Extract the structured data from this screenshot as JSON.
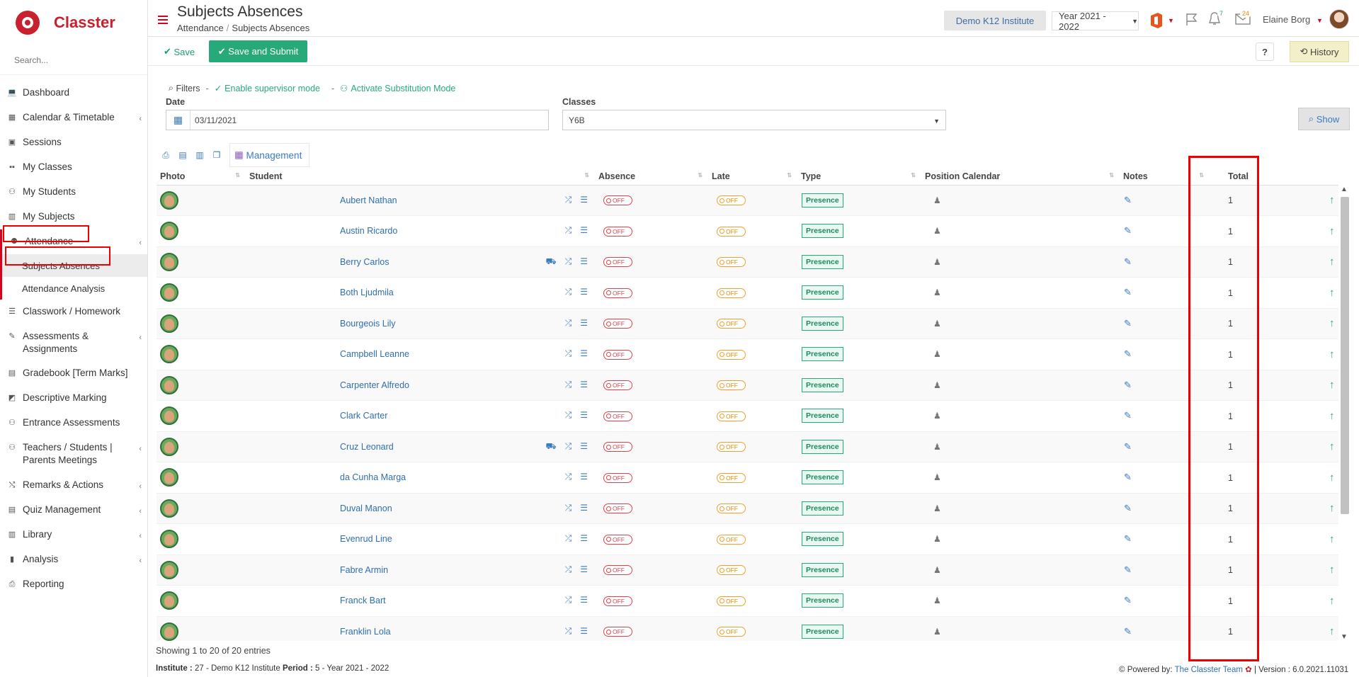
{
  "brand": {
    "name": "Classter"
  },
  "search": {
    "placeholder": "Search..."
  },
  "sidebar": {
    "items": [
      {
        "label": "Dashboard",
        "icon": "laptop-icon",
        "chevron": false
      },
      {
        "label": "Calendar & Timetable",
        "icon": "calendar-icon",
        "chevron": true
      },
      {
        "label": "Sessions",
        "icon": "sessions-icon",
        "chevron": false
      },
      {
        "label": "My Classes",
        "icon": "classes-icon",
        "chevron": false
      },
      {
        "label": "My Students",
        "icon": "students-icon",
        "chevron": false
      },
      {
        "label": "My Subjects",
        "icon": "book-icon",
        "chevron": false
      },
      {
        "label": "Attendance",
        "icon": "attendance-icon",
        "chevron": true
      }
    ],
    "sub_items": [
      {
        "label": "Subjects Absences",
        "selected": true
      },
      {
        "label": "Attendance Analysis",
        "selected": false
      }
    ],
    "items_after": [
      {
        "label": "Classwork / Homework",
        "icon": "homework-icon",
        "chevron": false
      },
      {
        "label": "Assessments & Assignments",
        "icon": "assessments-icon",
        "chevron": true
      },
      {
        "label": "Gradebook [Term Marks]",
        "icon": "gradebook-icon",
        "chevron": false
      },
      {
        "label": "Descriptive Marking",
        "icon": "marking-icon",
        "chevron": false
      },
      {
        "label": "Entrance Assessments",
        "icon": "entrance-icon",
        "chevron": false
      },
      {
        "label": "Teachers / Students | Parents Meetings",
        "icon": "meetings-icon",
        "chevron": true
      },
      {
        "label": "Remarks & Actions",
        "icon": "remarks-icon",
        "chevron": true
      },
      {
        "label": "Quiz Management",
        "icon": "quiz-icon",
        "chevron": true
      },
      {
        "label": "Library",
        "icon": "library-icon",
        "chevron": true
      },
      {
        "label": "Analysis",
        "icon": "analysis-icon",
        "chevron": true
      },
      {
        "label": "Reporting",
        "icon": "printer-icon",
        "chevron": false
      }
    ]
  },
  "header": {
    "title": "Subjects Absences",
    "breadcrumb": [
      "Attendance",
      "Subjects Absences"
    ],
    "institute": "Demo K12 Institute",
    "year": "Year 2021 - 2022",
    "notifications": "7",
    "messages": "24",
    "user": "Elaine Borg"
  },
  "toolbar": {
    "save_label": "Save",
    "submit_label": "Save and Submit",
    "help_label": "?",
    "history_label": "History"
  },
  "filters": {
    "label": "Filters",
    "supervisor": "Enable supervisor mode",
    "substitution": "Activate Substitution Mode",
    "date_label": "Date",
    "date_value": "03/11/2021",
    "classes_label": "Classes",
    "classes_value": "Y6B",
    "show_label": "Show"
  },
  "tools": {
    "management_label": "Management"
  },
  "table": {
    "columns": [
      "Photo",
      "Student",
      "Absence",
      "Late",
      "Type",
      "Position Calendar",
      "Notes",
      "Total"
    ],
    "toggle_off": "OFF",
    "presence": "Presence",
    "rows": [
      {
        "name": "Aubert Nathan",
        "bus": false,
        "total": "1"
      },
      {
        "name": "Austin Ricardo",
        "bus": false,
        "total": "1"
      },
      {
        "name": "Berry Carlos",
        "bus": true,
        "total": "1"
      },
      {
        "name": "Both Ljudmila",
        "bus": false,
        "total": "1"
      },
      {
        "name": "Bourgeois Lily",
        "bus": false,
        "total": "1"
      },
      {
        "name": "Campbell Leanne",
        "bus": false,
        "total": "1"
      },
      {
        "name": "Carpenter Alfredo",
        "bus": false,
        "total": "1"
      },
      {
        "name": "Clark Carter",
        "bus": false,
        "total": "1"
      },
      {
        "name": "Cruz Leonard",
        "bus": true,
        "total": "1"
      },
      {
        "name": "da Cunha Marga",
        "bus": false,
        "total": "1"
      },
      {
        "name": "Duval Manon",
        "bus": false,
        "total": "1"
      },
      {
        "name": "Evenrud Line",
        "bus": false,
        "total": "1"
      },
      {
        "name": "Fabre Armin",
        "bus": false,
        "total": "1"
      },
      {
        "name": "Franck Bart",
        "bus": false,
        "total": "1"
      },
      {
        "name": "Franklin Lola",
        "bus": false,
        "total": "1"
      }
    ]
  },
  "entries": "Showing 1 to 20 of 20 entries",
  "footer": {
    "institute_label": "Institute :",
    "institute_value": "27 - Demo K12 Institute",
    "period_label": "Period :",
    "period_value": "5 - Year 2021 - 2022",
    "powered": "Powered by:",
    "team": "The Classter Team",
    "version": "| Version : 6.0.2021.11031"
  },
  "colors": {
    "brand": "#c8202f",
    "accent": "#27a97a",
    "link": "#2f6fae",
    "highlight": "#ee0000"
  }
}
